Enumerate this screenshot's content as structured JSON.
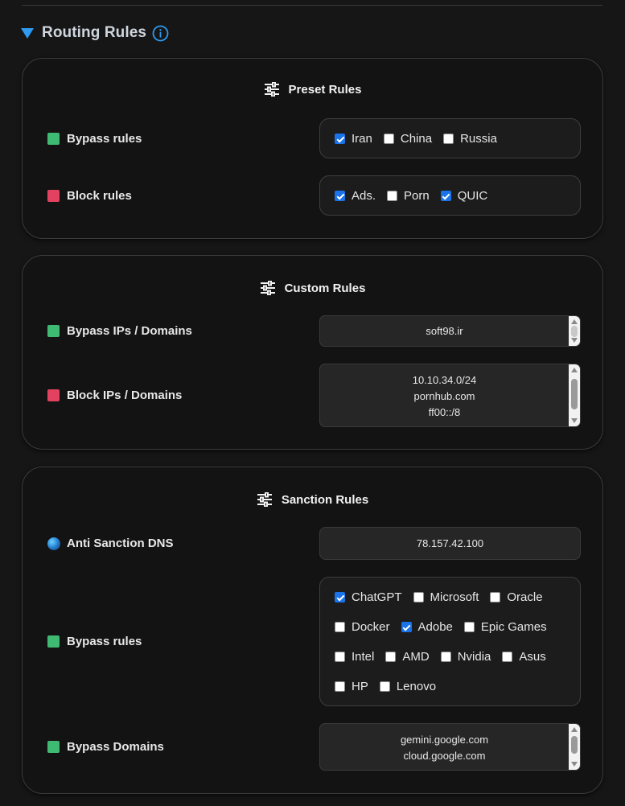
{
  "section": {
    "title": "Routing Rules"
  },
  "preset": {
    "title": "Preset Rules",
    "bypass_label": "Bypass rules",
    "bypass_options": [
      {
        "label": "Iran",
        "checked": true
      },
      {
        "label": "China",
        "checked": false
      },
      {
        "label": "Russia",
        "checked": false
      }
    ],
    "block_label": "Block rules",
    "block_options": [
      {
        "label": "Ads.",
        "checked": true
      },
      {
        "label": "Porn",
        "checked": false
      },
      {
        "label": "QUIC",
        "checked": true
      }
    ]
  },
  "custom": {
    "title": "Custom Rules",
    "bypass_label": "Bypass IPs / Domains",
    "bypass_lines": [
      "soft98.ir"
    ],
    "block_label": "Block IPs / Domains",
    "block_lines": [
      "10.10.34.0/24",
      "pornhub.com",
      "ff00::/8"
    ]
  },
  "sanction": {
    "title": "Sanction Rules",
    "dns_label": "Anti Sanction DNS",
    "dns_value": "78.157.42.100",
    "bypass_label": "Bypass rules",
    "bypass_rows": [
      [
        {
          "label": "ChatGPT",
          "checked": true
        },
        {
          "label": "Microsoft",
          "checked": false
        },
        {
          "label": "Oracle",
          "checked": false
        }
      ],
      [
        {
          "label": "Docker",
          "checked": false
        },
        {
          "label": "Adobe",
          "checked": true
        },
        {
          "label": "Epic Games",
          "checked": false
        }
      ],
      [
        {
          "label": "Intel",
          "checked": false
        },
        {
          "label": "AMD",
          "checked": false
        },
        {
          "label": "Nvidia",
          "checked": false
        },
        {
          "label": "Asus",
          "checked": false
        }
      ],
      [
        {
          "label": "HP",
          "checked": false
        },
        {
          "label": "Lenovo",
          "checked": false
        }
      ]
    ],
    "domains_label": "Bypass Domains",
    "domains_lines": [
      "gemini.google.com",
      "cloud.google.com"
    ]
  },
  "icons": {
    "collapse": "triangle-down-icon",
    "info": "info-icon",
    "sliders": "sliders-icon",
    "bypass_marker": "green-square-icon",
    "block_marker": "red-square-icon",
    "dns_marker": "globe-icon"
  },
  "colors": {
    "accent": "#2f9bf0",
    "green": "#3fba72",
    "red": "#e2415f",
    "checkbox": "#1a73e8"
  }
}
